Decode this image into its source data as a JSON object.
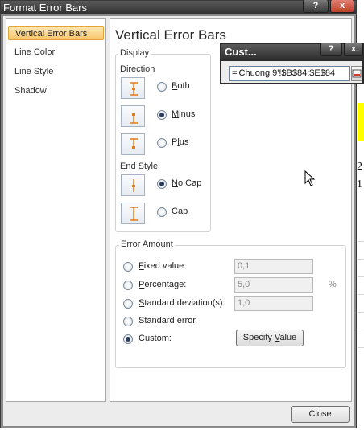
{
  "window": {
    "title": "Format Error Bars",
    "help_glyph": "?",
    "close_glyph": "x"
  },
  "nav": {
    "items": [
      {
        "label": "Vertical Error Bars",
        "selected": true
      },
      {
        "label": "Line Color",
        "selected": false
      },
      {
        "label": "Line Style",
        "selected": false
      },
      {
        "label": "Shadow",
        "selected": false
      }
    ]
  },
  "pane": {
    "title": "Vertical Error Bars",
    "display": {
      "group_label": "Display",
      "direction_label": "Direction",
      "direction_options": [
        {
          "label": "Both",
          "accel": "B",
          "rest": "oth",
          "checked": false,
          "icon": "error-bar-both-icon"
        },
        {
          "label": "Minus",
          "accel": "M",
          "rest": "inus",
          "checked": true,
          "icon": "error-bar-minus-icon"
        },
        {
          "label": "Plus",
          "accel": "l",
          "pre": "P",
          "rest": "us",
          "checked": false,
          "icon": "error-bar-plus-icon"
        }
      ],
      "end_style_label": "End Style",
      "end_style_options": [
        {
          "label": "No Cap",
          "accel": "N",
          "rest": "o Cap",
          "checked": true,
          "icon": "no-cap-icon"
        },
        {
          "label": "Cap",
          "accel": "C",
          "rest": "ap",
          "checked": false,
          "icon": "cap-icon"
        }
      ]
    },
    "error_amount": {
      "group_label": "Error Amount",
      "options": [
        {
          "label": "Fixed value:",
          "accel": "F",
          "rest": "ixed value:",
          "checked": false,
          "value": "0,1"
        },
        {
          "label": "Percentage:",
          "accel": "P",
          "rest": "ercentage:",
          "checked": false,
          "value": "5,0",
          "suffix": "%"
        },
        {
          "label": "Standard deviation(s):",
          "accel": "S",
          "rest": "tandard deviation(s):",
          "checked": false,
          "value": "1,0"
        },
        {
          "label": "Standard error",
          "accel": "",
          "rest": "Standard error",
          "checked": false
        },
        {
          "label": "Custom:",
          "accel": "C",
          "rest": "ustom:",
          "checked": true
        }
      ],
      "specify_value_label": "Specify Value",
      "specify_pre": "Specify ",
      "specify_accel": "V",
      "specify_rest": "alue"
    }
  },
  "footer": {
    "close_label": "Close"
  },
  "custom_dialog": {
    "title": "Cust...",
    "help_glyph": "?",
    "close_glyph": "x",
    "range_value": "='Chuong 9'!$B$84:$E$84"
  },
  "sheet_background": {
    "cell_text_1": "2",
    "cell_text_2": "1"
  },
  "colors": {
    "accent_orange": "#f8c56a",
    "icon_orange": "#e07a1f",
    "highlight_yellow": "#ffff00"
  }
}
